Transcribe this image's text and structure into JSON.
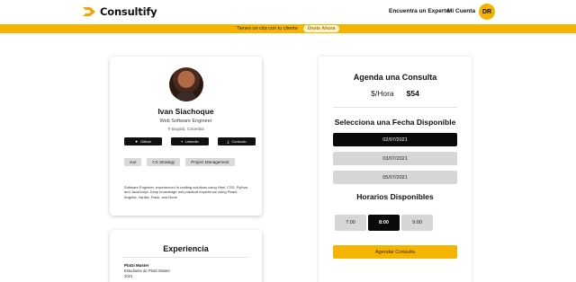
{
  "header": {
    "brand": "Consultify",
    "nav_expert": "Encuentra un Experto",
    "nav_account": "Mi Cuenta",
    "avatar_initials": "DR",
    "accent_color": "#f5b400"
  },
  "promo": {
    "text": "Tienes un cita con tu cliente",
    "button": "Únete Ahora"
  },
  "profile": {
    "name": "Ivan Siachoque",
    "role": "Web Software Engineer",
    "location": "Bogotá, Colombia",
    "location_icon": "pin-icon",
    "socials": [
      {
        "label": "Github",
        "icon": "github-icon"
      },
      {
        "label": "Linkedin",
        "icon": "linkedin-icon"
      },
      {
        "label": "Currículo",
        "icon": "download-icon"
      }
    ],
    "tags": [
      "vue",
      "CX Strategy",
      "Project Management"
    ],
    "bio": "Software Engineer, experienced in crafting solutions using Html, CSS, Python, and JavaScript. Deep knowledge and practical experience using React, Angular, Vanilla, Flask, and Node"
  },
  "experience": {
    "title": "Experiencia",
    "items": [
      {
        "org": "Platzi Master",
        "role": "Estudiante de Platzi Master",
        "year": "2021"
      }
    ]
  },
  "booking": {
    "title": "Agenda una Consulta",
    "price_unit": "$/Hora",
    "price_value": "$54",
    "date_title": "Selecciona una Fecha Disponible",
    "dates": [
      "02/07/2021",
      "03/07/2021",
      "05/07/2021"
    ],
    "selected_date": "02/07/2021",
    "time_title": "Horarios Disponibles",
    "times": [
      "7:00",
      "8:00",
      "9:00"
    ],
    "selected_time": "8:00",
    "cta": "Agendar Consulta"
  }
}
